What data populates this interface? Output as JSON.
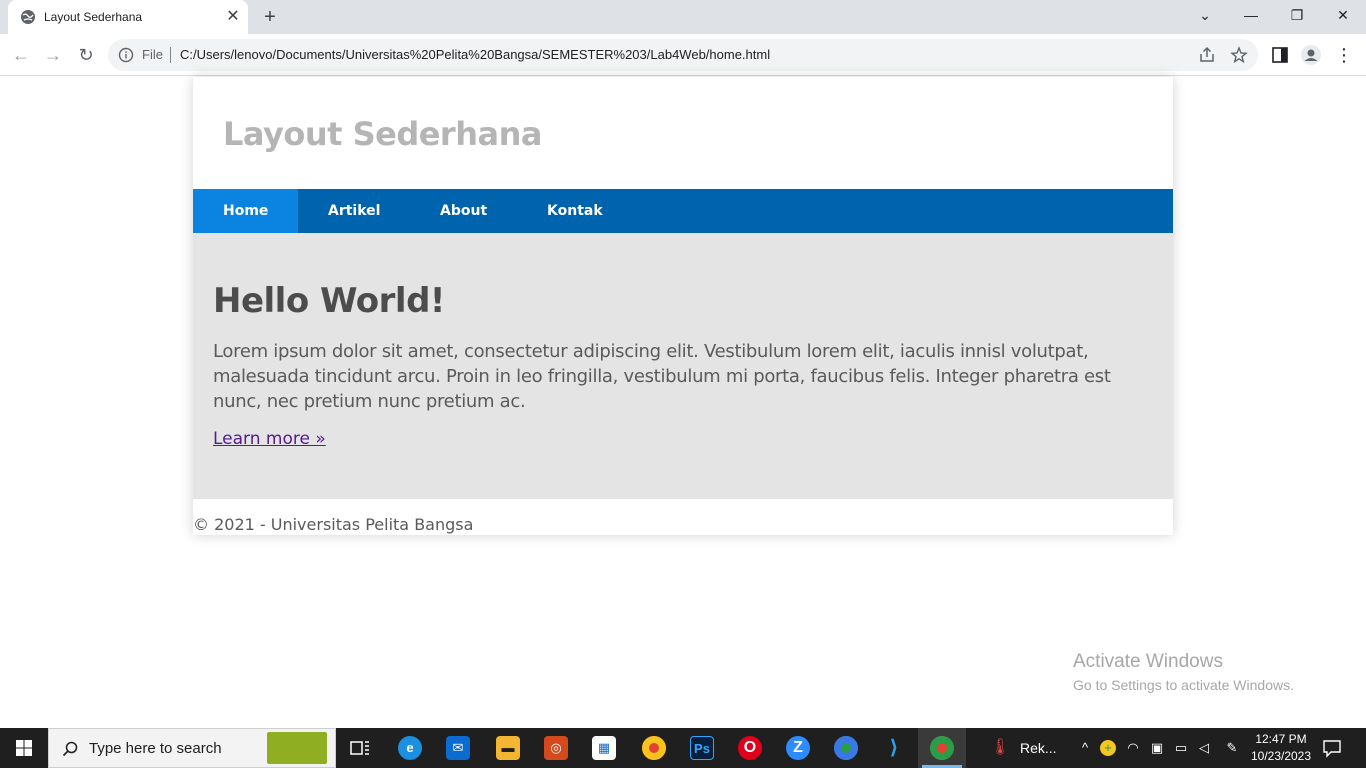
{
  "browser": {
    "tab_title": "Layout Sederhana",
    "address_scheme": "File",
    "address_url": "C:/Users/lenovo/Documents/Universitas%20Pelita%20Bangsa/SEMESTER%203/Lab4Web/home.html"
  },
  "site": {
    "title": "Layout Sederhana",
    "nav": [
      {
        "label": "Home"
      },
      {
        "label": "Artikel"
      },
      {
        "label": "About"
      },
      {
        "label": "Kontak"
      }
    ],
    "hero": {
      "title": "Hello World!",
      "text": "Lorem ipsum dolor sit amet, consectetur adipiscing elit. Vestibulum lorem elit, iaculis innisl volutpat, malesuada tincidunt arcu. Proin in leo fringilla, vestibulum mi porta, faucibus felis. Integer pharetra est nunc, nec pretium nunc pretium ac.",
      "link": "Learn more »"
    },
    "footer": "© 2021 - Universitas Pelita Bangsa"
  },
  "watermark": {
    "title": "Activate Windows",
    "subtitle": "Go to Settings to activate Windows."
  },
  "taskbar": {
    "search_placeholder": "Type here to search",
    "running_app_label": "Rek...",
    "time": "12:47 PM",
    "date": "10/23/2023"
  },
  "colors": {
    "nav_bg": "#0063ad",
    "nav_active": "#0a84e0",
    "hero_bg": "#e4e4e4",
    "link": "#551a8b"
  }
}
